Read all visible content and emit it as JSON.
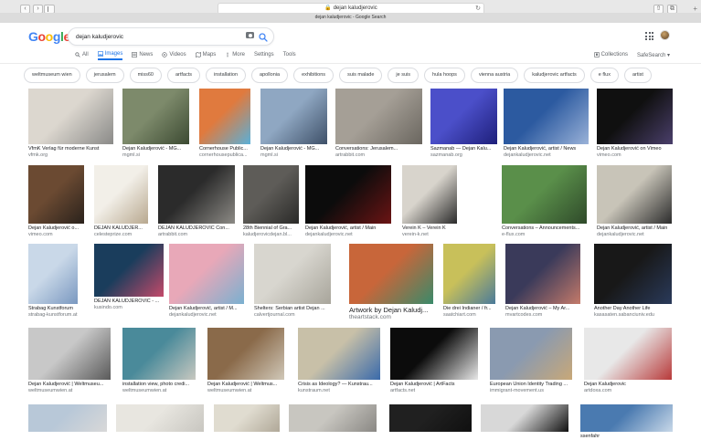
{
  "browser": {
    "url": "dejan kaludjerovic",
    "tab_title": "dejan kaludjerovic - Google Search",
    "back_glyph": "‹",
    "forward_glyph": "›",
    "reload_glyph": "↻",
    "share_glyph": "⇧",
    "tabs_glyph": "⧉",
    "new_tab_glyph": "+"
  },
  "logo": [
    "G",
    "o",
    "o",
    "g",
    "l",
    "e"
  ],
  "search": {
    "value": "dejan kaludjerovic"
  },
  "tabs": [
    {
      "label": "All",
      "icon": "search-icon"
    },
    {
      "label": "Images",
      "icon": "image-icon",
      "active": true
    },
    {
      "label": "News",
      "icon": "news-icon"
    },
    {
      "label": "Videos",
      "icon": "video-icon"
    },
    {
      "label": "Maps",
      "icon": "map-icon"
    },
    {
      "label": "More",
      "icon": "more-icon"
    },
    {
      "label": "Settings"
    },
    {
      "label": "Tools"
    }
  ],
  "right_tools": {
    "collections": "Collections",
    "safesearch": "SafeSearch ▾"
  },
  "chips": [
    "weltmuseum wien",
    "jerusalem",
    "miss60",
    "artfacts",
    "installation",
    "apollonia",
    "exhibitions",
    "suis malade",
    "je suis",
    "hula hoops",
    "vienna austria",
    "kaludjerovic artfacts",
    "e flux",
    "artist"
  ],
  "results": [
    {
      "caption": "VfmK Verlag für moderne Kunst",
      "source": "vfmk.org",
      "colors": [
        "#dcd7cf",
        "#8a8a88"
      ]
    },
    {
      "caption": "Dejan Kaludjerović - MG...",
      "source": "mgml.si",
      "colors": [
        "#7d8a6b",
        "#3c4a32"
      ]
    },
    {
      "caption": "Cornerhouse Public...",
      "source": "cornerhousepublica...",
      "colors": [
        "#e07a3e",
        "#5ab0d8"
      ]
    },
    {
      "caption": "Dejan Kaludjerović - MG...",
      "source": "mgml.si",
      "colors": [
        "#8fa7c2",
        "#3e5068"
      ]
    },
    {
      "caption": "Conversations: Jerusalem...",
      "source": "artrabbit.com",
      "colors": [
        "#a59f96",
        "#6a665f"
      ]
    },
    {
      "caption": "Sazmanab — Dejan Kalu...",
      "source": "sazmanab.org",
      "colors": [
        "#4b4fc9",
        "#1e1f7a"
      ]
    },
    {
      "caption": "Dejan Kaludjerović, artist / News",
      "source": "dejankaludjerovic.net",
      "colors": [
        "#2c5aa0",
        "#9ab2d8"
      ]
    },
    {
      "caption": "Dejan Kaludjerović on Vimeo",
      "source": "vimeo.com",
      "colors": [
        "#101010",
        "#4a3f6b"
      ]
    },
    {
      "caption": "Dejan Kaludjerović o...",
      "source": "vimeo.com",
      "colors": [
        "#6b4a32",
        "#2a221c"
      ]
    },
    {
      "caption": "DEJAN KALUDJER...",
      "source": "celesteprize.com",
      "colors": [
        "#f2efe8",
        "#b8a88f"
      ]
    },
    {
      "caption": "DEJAN KALUDJEROVIĆ Con...",
      "source": "artrabbit.com",
      "colors": [
        "#2b2b2b",
        "#8c8a85"
      ]
    },
    {
      "caption": "28th Biennial of Gra...",
      "source": "kaludjerovicdejan.bl...",
      "colors": [
        "#5e5c58",
        "#2a2a28"
      ]
    },
    {
      "caption": "Dejan Kaludjerović, artist / Main",
      "source": "dejankaludjerovic.net",
      "colors": [
        "#0c0c0c",
        "#6b1414"
      ]
    },
    {
      "caption": "Verein K – Verein K",
      "source": "verein-k.net",
      "colors": [
        "#d8d4cc",
        "#2a2a2a"
      ]
    },
    {
      "caption": "Conversations – Announcements...",
      "source": "e-flux.com",
      "colors": [
        "#5a8f4a",
        "#2f4a2a"
      ]
    },
    {
      "caption": "Dejan Kaludjerović, artist / Main",
      "source": "dejankaludjerovic.net",
      "colors": [
        "#c8c4b8",
        "#2c2c2c"
      ]
    },
    {
      "caption": "Strabag Kunstforum",
      "source": "strabag-kunstforum.at",
      "colors": [
        "#c9d8e8",
        "#7a98c0"
      ]
    },
    {
      "caption": "DEJAN KALUDJEROVIĆ - ...",
      "source": "kusindo.com",
      "colors": [
        "#1a3d5c",
        "#c44a6a"
      ]
    },
    {
      "caption": "Dejan Kaludjerović, artist / M...",
      "source": "dejankaludjerovic.net",
      "colors": [
        "#e8a8b8",
        "#7ab0d0"
      ]
    },
    {
      "caption": "Shelters: Serbian artist Dejan ...",
      "source": "calvertjournal.com",
      "colors": [
        "#d8d6cf",
        "#a8a59b"
      ]
    },
    {
      "caption": "Artwork by Dejan Kaludj...",
      "source": "theartstack.com",
      "colors": [
        "#c8663a",
        "#3a8a6a"
      ]
    },
    {
      "caption": "Die drei Indianer / fr...",
      "source": "saatchiart.com",
      "colors": [
        "#c8c05a",
        "#4a7a9a"
      ]
    },
    {
      "caption": "Dejan Kaludjerović – My Ar...",
      "source": "mvartcodes.com",
      "colors": [
        "#3a3a5a",
        "#c47a6a"
      ]
    },
    {
      "caption": "Another Day Another Life",
      "source": "kasasaten.sabanciuniv.edu",
      "colors": [
        "#181818",
        "#2a3a5a"
      ]
    },
    {
      "caption": "Dejan Kaludjerović | Weltmuseu...",
      "source": "weltmuseumwien.at",
      "colors": [
        "#c8c8c8",
        "#5a5a5a"
      ]
    },
    {
      "caption": "installation view, photo credi...",
      "source": "weltmuseumwien.at",
      "colors": [
        "#4a8a9a",
        "#c8c8c0"
      ]
    },
    {
      "caption": "Dejan Kaludjerović | Weltmus...",
      "source": "weltmuseumwien.at",
      "colors": [
        "#8a6a4a",
        "#d0c8b8"
      ]
    },
    {
      "caption": "Crisis as Ideology? — Kunstrau...",
      "source": "kunstraum.net",
      "colors": [
        "#c8c0a8",
        "#3a6aaa"
      ]
    },
    {
      "caption": "Dejan Kaludjerović | ArtFacts",
      "source": "artfacts.net",
      "colors": [
        "#0c0c0c",
        "#e8e8e8"
      ]
    },
    {
      "caption": "European Union Identity Trading ...",
      "source": "immigrant-movement.us",
      "colors": [
        "#8a9ab0",
        "#c8a878"
      ]
    },
    {
      "caption": "Dejan Kaludjerovic",
      "source": "artdoxa.com",
      "colors": [
        "#e8e8e8",
        "#b83a3a"
      ]
    },
    {
      "caption": "",
      "source": "",
      "colors": [
        "#b8c8d8",
        "#d8d8d8"
      ]
    },
    {
      "caption": "",
      "source": "",
      "colors": [
        "#e8e6e0",
        "#c8c6c0"
      ]
    },
    {
      "caption": "",
      "source": "",
      "colors": [
        "#e0dcd0",
        "#b0a898"
      ]
    },
    {
      "caption": "",
      "source": "",
      "colors": [
        "#c8c6c0",
        "#8a8884"
      ]
    },
    {
      "caption": "",
      "source": "",
      "colors": [
        "#202020",
        "#101010"
      ]
    },
    {
      "caption": "",
      "source": "",
      "colors": [
        "#d8d8d8",
        "#101010"
      ]
    },
    {
      "caption": "ssenfahr",
      "source": "",
      "colors": [
        "#4a7ab0",
        "#c8d8e8"
      ]
    }
  ]
}
